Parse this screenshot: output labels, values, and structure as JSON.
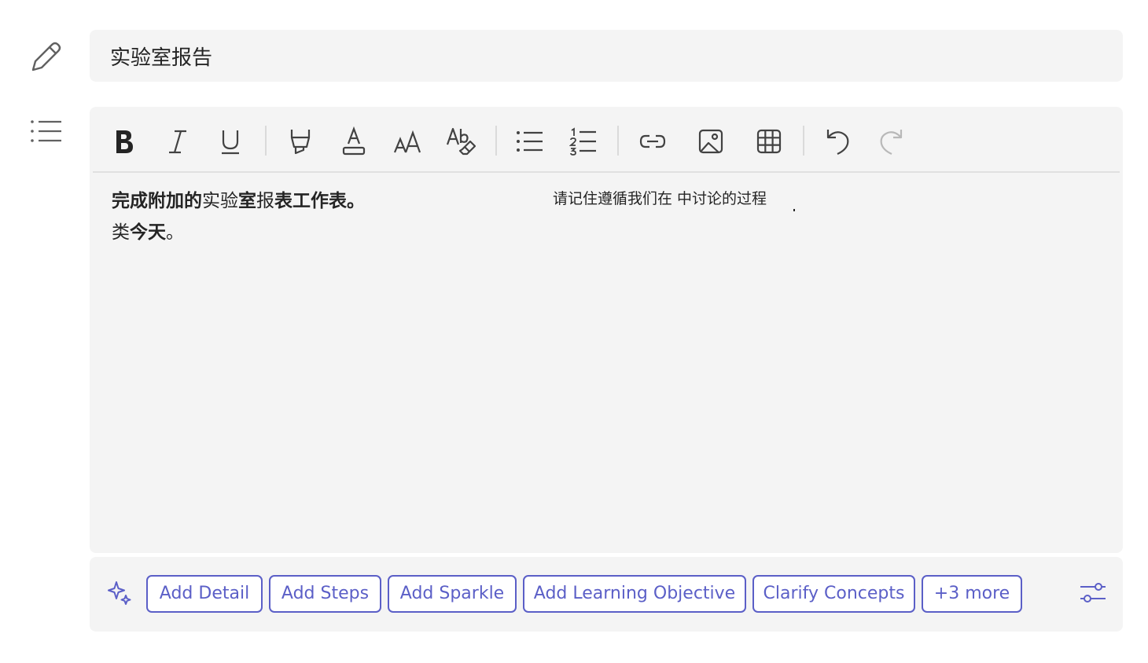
{
  "title": {
    "value": "实验室报告"
  },
  "toolbar": {
    "buttons": [
      {
        "name": "bold",
        "icon": "bold-icon"
      },
      {
        "name": "italic",
        "icon": "italic-icon"
      },
      {
        "name": "underline",
        "icon": "underline-icon"
      },
      {
        "name": "highlight",
        "icon": "highlighter-icon"
      },
      {
        "name": "font-color",
        "icon": "font-color-icon"
      },
      {
        "name": "font-size",
        "icon": "font-size-icon"
      },
      {
        "name": "clear-format",
        "icon": "clear-format-icon"
      },
      {
        "name": "bulleted-list",
        "icon": "bulleted-list-icon"
      },
      {
        "name": "numbered-list",
        "icon": "numbered-list-icon"
      },
      {
        "name": "insert-link",
        "icon": "link-icon"
      },
      {
        "name": "insert-image",
        "icon": "image-icon"
      },
      {
        "name": "insert-table",
        "icon": "table-icon"
      },
      {
        "name": "undo",
        "icon": "undo-icon"
      },
      {
        "name": "redo",
        "icon": "redo-icon",
        "disabled": true
      }
    ]
  },
  "body": {
    "line1_a": "完成附加的",
    "line1_b": "实验",
    "line1_c": "室",
    "line1_d": "报",
    "line1_e": "表工作表。",
    "line2_a": "类",
    "line2_b": "今天",
    "line2_c": "。",
    "floating": "请记住遵循我们在 中讨论的过程"
  },
  "suggestions": {
    "chips": [
      "Add Detail",
      "Add Steps",
      "Add Sparkle",
      "Add Learning Objective",
      "Clarify Concepts",
      "+3 more"
    ]
  },
  "colors": {
    "accent": "#5b5fc7",
    "panel": "#f4f4f4",
    "text": "#242424"
  }
}
